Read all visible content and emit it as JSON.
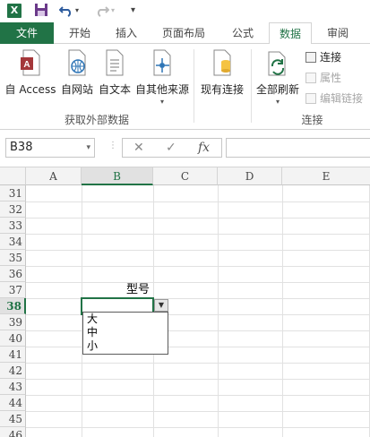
{
  "qat": {
    "app_icon": "X",
    "save_icon": "save-icon",
    "undo_icon": "undo-icon",
    "redo_icon": "redo-icon",
    "customize_icon": "customize-icon"
  },
  "tabs": {
    "file": "文件",
    "home": "开始",
    "insert": "插入",
    "page_layout": "页面布局",
    "formulas": "公式",
    "data": "数据",
    "review": "审阅"
  },
  "ribbon": {
    "get_external": {
      "from_access": "自 Access",
      "from_web": "自网站",
      "from_text": "自文本",
      "from_other": "自其他来源",
      "label": "获取外部数据"
    },
    "existing_connections": "现有连接",
    "connections": {
      "refresh_all": "全部刷新",
      "connections": "连接",
      "properties": "属性",
      "edit_links": "编辑链接",
      "label": "连接"
    }
  },
  "formula_bar": {
    "name_box": "B38",
    "cancel": "✕",
    "enter": "✓",
    "fx": "fx",
    "formula": ""
  },
  "sheet": {
    "columns": [
      "A",
      "B",
      "C",
      "D",
      "E"
    ],
    "active_column": "B",
    "rows": [
      "31",
      "32",
      "33",
      "34",
      "35",
      "36",
      "37",
      "38",
      "39",
      "40",
      "41",
      "42",
      "43",
      "44",
      "45",
      "46"
    ],
    "active_row": "38",
    "cell_b37": "型号",
    "dropdown_options": [
      "大",
      "中",
      "小"
    ]
  },
  "colors": {
    "accent": "#217346",
    "grid": "#e1e1e1",
    "header_bg": "#f3f3f3"
  }
}
